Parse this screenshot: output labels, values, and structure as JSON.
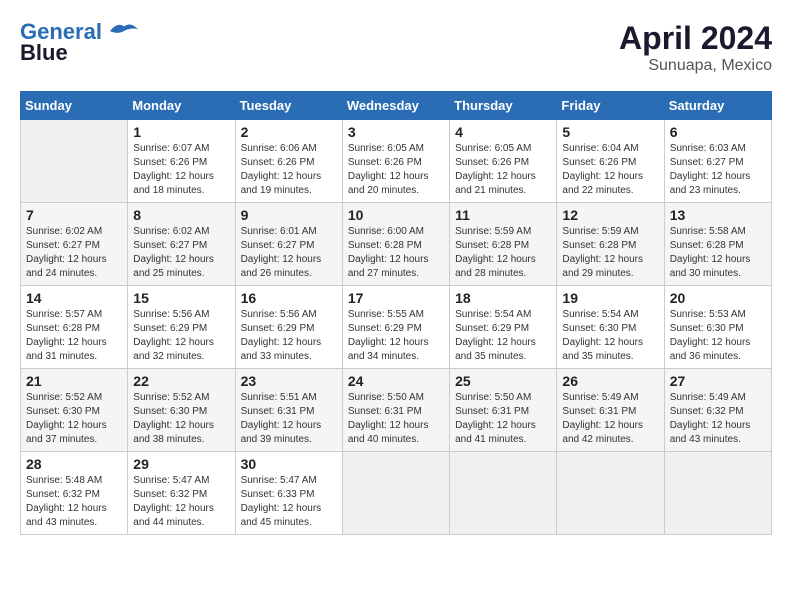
{
  "header": {
    "logo_line1": "General",
    "logo_line2": "Blue",
    "month_year": "April 2024",
    "location": "Sunuapa, Mexico"
  },
  "days_of_week": [
    "Sunday",
    "Monday",
    "Tuesday",
    "Wednesday",
    "Thursday",
    "Friday",
    "Saturday"
  ],
  "weeks": [
    [
      {
        "day": "",
        "sunrise": "",
        "sunset": "",
        "daylight": ""
      },
      {
        "day": "1",
        "sunrise": "Sunrise: 6:07 AM",
        "sunset": "Sunset: 6:26 PM",
        "daylight": "Daylight: 12 hours and 18 minutes."
      },
      {
        "day": "2",
        "sunrise": "Sunrise: 6:06 AM",
        "sunset": "Sunset: 6:26 PM",
        "daylight": "Daylight: 12 hours and 19 minutes."
      },
      {
        "day": "3",
        "sunrise": "Sunrise: 6:05 AM",
        "sunset": "Sunset: 6:26 PM",
        "daylight": "Daylight: 12 hours and 20 minutes."
      },
      {
        "day": "4",
        "sunrise": "Sunrise: 6:05 AM",
        "sunset": "Sunset: 6:26 PM",
        "daylight": "Daylight: 12 hours and 21 minutes."
      },
      {
        "day": "5",
        "sunrise": "Sunrise: 6:04 AM",
        "sunset": "Sunset: 6:26 PM",
        "daylight": "Daylight: 12 hours and 22 minutes."
      },
      {
        "day": "6",
        "sunrise": "Sunrise: 6:03 AM",
        "sunset": "Sunset: 6:27 PM",
        "daylight": "Daylight: 12 hours and 23 minutes."
      }
    ],
    [
      {
        "day": "7",
        "sunrise": "Sunrise: 6:02 AM",
        "sunset": "Sunset: 6:27 PM",
        "daylight": "Daylight: 12 hours and 24 minutes."
      },
      {
        "day": "8",
        "sunrise": "Sunrise: 6:02 AM",
        "sunset": "Sunset: 6:27 PM",
        "daylight": "Daylight: 12 hours and 25 minutes."
      },
      {
        "day": "9",
        "sunrise": "Sunrise: 6:01 AM",
        "sunset": "Sunset: 6:27 PM",
        "daylight": "Daylight: 12 hours and 26 minutes."
      },
      {
        "day": "10",
        "sunrise": "Sunrise: 6:00 AM",
        "sunset": "Sunset: 6:28 PM",
        "daylight": "Daylight: 12 hours and 27 minutes."
      },
      {
        "day": "11",
        "sunrise": "Sunrise: 5:59 AM",
        "sunset": "Sunset: 6:28 PM",
        "daylight": "Daylight: 12 hours and 28 minutes."
      },
      {
        "day": "12",
        "sunrise": "Sunrise: 5:59 AM",
        "sunset": "Sunset: 6:28 PM",
        "daylight": "Daylight: 12 hours and 29 minutes."
      },
      {
        "day": "13",
        "sunrise": "Sunrise: 5:58 AM",
        "sunset": "Sunset: 6:28 PM",
        "daylight": "Daylight: 12 hours and 30 minutes."
      }
    ],
    [
      {
        "day": "14",
        "sunrise": "Sunrise: 5:57 AM",
        "sunset": "Sunset: 6:28 PM",
        "daylight": "Daylight: 12 hours and 31 minutes."
      },
      {
        "day": "15",
        "sunrise": "Sunrise: 5:56 AM",
        "sunset": "Sunset: 6:29 PM",
        "daylight": "Daylight: 12 hours and 32 minutes."
      },
      {
        "day": "16",
        "sunrise": "Sunrise: 5:56 AM",
        "sunset": "Sunset: 6:29 PM",
        "daylight": "Daylight: 12 hours and 33 minutes."
      },
      {
        "day": "17",
        "sunrise": "Sunrise: 5:55 AM",
        "sunset": "Sunset: 6:29 PM",
        "daylight": "Daylight: 12 hours and 34 minutes."
      },
      {
        "day": "18",
        "sunrise": "Sunrise: 5:54 AM",
        "sunset": "Sunset: 6:29 PM",
        "daylight": "Daylight: 12 hours and 35 minutes."
      },
      {
        "day": "19",
        "sunrise": "Sunrise: 5:54 AM",
        "sunset": "Sunset: 6:30 PM",
        "daylight": "Daylight: 12 hours and 35 minutes."
      },
      {
        "day": "20",
        "sunrise": "Sunrise: 5:53 AM",
        "sunset": "Sunset: 6:30 PM",
        "daylight": "Daylight: 12 hours and 36 minutes."
      }
    ],
    [
      {
        "day": "21",
        "sunrise": "Sunrise: 5:52 AM",
        "sunset": "Sunset: 6:30 PM",
        "daylight": "Daylight: 12 hours and 37 minutes."
      },
      {
        "day": "22",
        "sunrise": "Sunrise: 5:52 AM",
        "sunset": "Sunset: 6:30 PM",
        "daylight": "Daylight: 12 hours and 38 minutes."
      },
      {
        "day": "23",
        "sunrise": "Sunrise: 5:51 AM",
        "sunset": "Sunset: 6:31 PM",
        "daylight": "Daylight: 12 hours and 39 minutes."
      },
      {
        "day": "24",
        "sunrise": "Sunrise: 5:50 AM",
        "sunset": "Sunset: 6:31 PM",
        "daylight": "Daylight: 12 hours and 40 minutes."
      },
      {
        "day": "25",
        "sunrise": "Sunrise: 5:50 AM",
        "sunset": "Sunset: 6:31 PM",
        "daylight": "Daylight: 12 hours and 41 minutes."
      },
      {
        "day": "26",
        "sunrise": "Sunrise: 5:49 AM",
        "sunset": "Sunset: 6:31 PM",
        "daylight": "Daylight: 12 hours and 42 minutes."
      },
      {
        "day": "27",
        "sunrise": "Sunrise: 5:49 AM",
        "sunset": "Sunset: 6:32 PM",
        "daylight": "Daylight: 12 hours and 43 minutes."
      }
    ],
    [
      {
        "day": "28",
        "sunrise": "Sunrise: 5:48 AM",
        "sunset": "Sunset: 6:32 PM",
        "daylight": "Daylight: 12 hours and 43 minutes."
      },
      {
        "day": "29",
        "sunrise": "Sunrise: 5:47 AM",
        "sunset": "Sunset: 6:32 PM",
        "daylight": "Daylight: 12 hours and 44 minutes."
      },
      {
        "day": "30",
        "sunrise": "Sunrise: 5:47 AM",
        "sunset": "Sunset: 6:33 PM",
        "daylight": "Daylight: 12 hours and 45 minutes."
      },
      {
        "day": "",
        "sunrise": "",
        "sunset": "",
        "daylight": ""
      },
      {
        "day": "",
        "sunrise": "",
        "sunset": "",
        "daylight": ""
      },
      {
        "day": "",
        "sunrise": "",
        "sunset": "",
        "daylight": ""
      },
      {
        "day": "",
        "sunrise": "",
        "sunset": "",
        "daylight": ""
      }
    ]
  ]
}
